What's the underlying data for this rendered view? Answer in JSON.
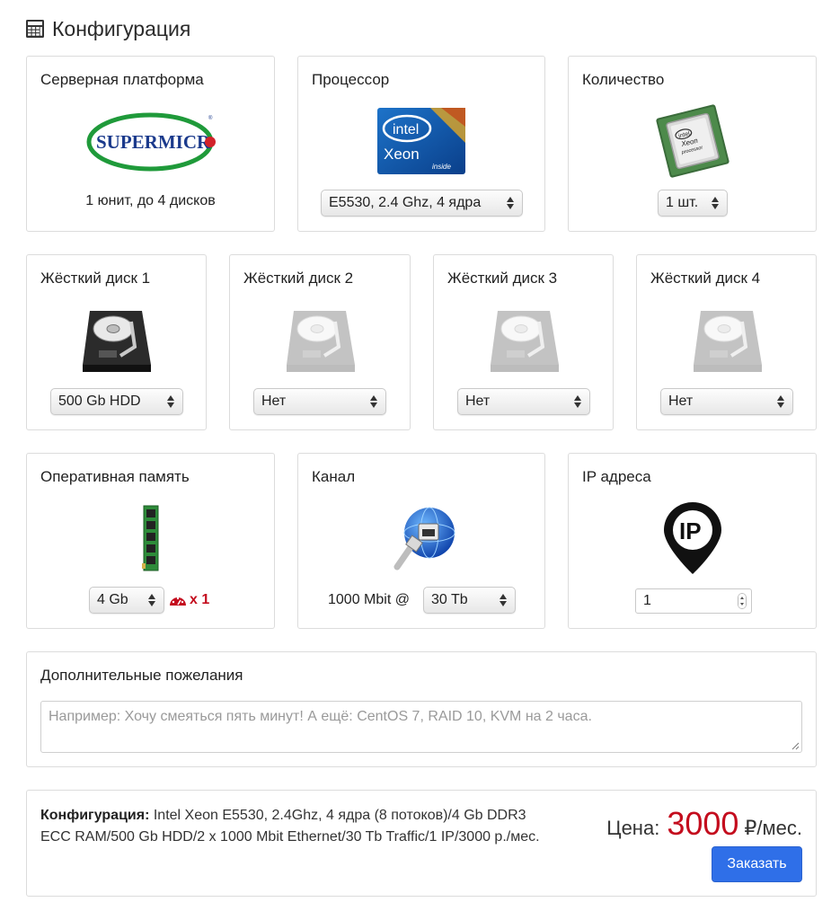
{
  "header": {
    "title": "Конфигурация",
    "icon": "calculator-icon"
  },
  "platform": {
    "title": "Серверная платформа",
    "logo_text": "SUPERMICR",
    "logo_dot_color": "#d2232a",
    "logo_color": "#1b3a8c",
    "ring_color": "#1f9a3a",
    "description": "1 юнит, до 4 дисков"
  },
  "processor": {
    "title": "Процессор",
    "badge": {
      "brand": "intel",
      "model": "Xeon",
      "sub": "inside"
    },
    "selected": "E5530, 2.4 Ghz, 4 ядра"
  },
  "quantity": {
    "title": "Количество",
    "chip": {
      "brand": "intel",
      "model": "Xeon",
      "sub": "processor"
    },
    "selected": "1 шт."
  },
  "disks": [
    {
      "title": "Жёсткий диск 1",
      "selected": "500 Gb HDD",
      "active": true
    },
    {
      "title": "Жёсткий диск 2",
      "selected": "Нет",
      "active": false
    },
    {
      "title": "Жёсткий диск 3",
      "selected": "Нет",
      "active": false
    },
    {
      "title": "Жёсткий диск 4",
      "selected": "Нет",
      "active": false
    }
  ],
  "ram": {
    "title": "Оперативная память",
    "selected": "4 Gb",
    "multiplier": "x 1",
    "multiplier_color": "#c40d1e"
  },
  "channel": {
    "title": "Канал",
    "speed": "1000 Mbit @",
    "selected": "30 Tb"
  },
  "ip": {
    "title": "IP адреса",
    "badge_text": "IP",
    "value": "1"
  },
  "notes": {
    "title": "Дополнительные пожелания",
    "placeholder": "Например: Хочу смеяться пять минут! А ещё: CentOS 7, RAID 10, KVM на 2 часа."
  },
  "summary": {
    "label": "Конфигурация:",
    "text": "Intel Xeon E5530, 2.4Ghz, 4 ядра (8 потоков)/4 Gb DDR3 ECC RAM/500 Gb HDD/2 x 1000 Mbit Ethernet/30 Tb Traffic/1 IP/3000 р./мес.",
    "price_label": "Цена:",
    "price_amount": "3000",
    "price_suffix": "₽/мес.",
    "price_color": "#c40d1e",
    "order_button": "Заказать",
    "button_color": "#2f6fe8"
  }
}
